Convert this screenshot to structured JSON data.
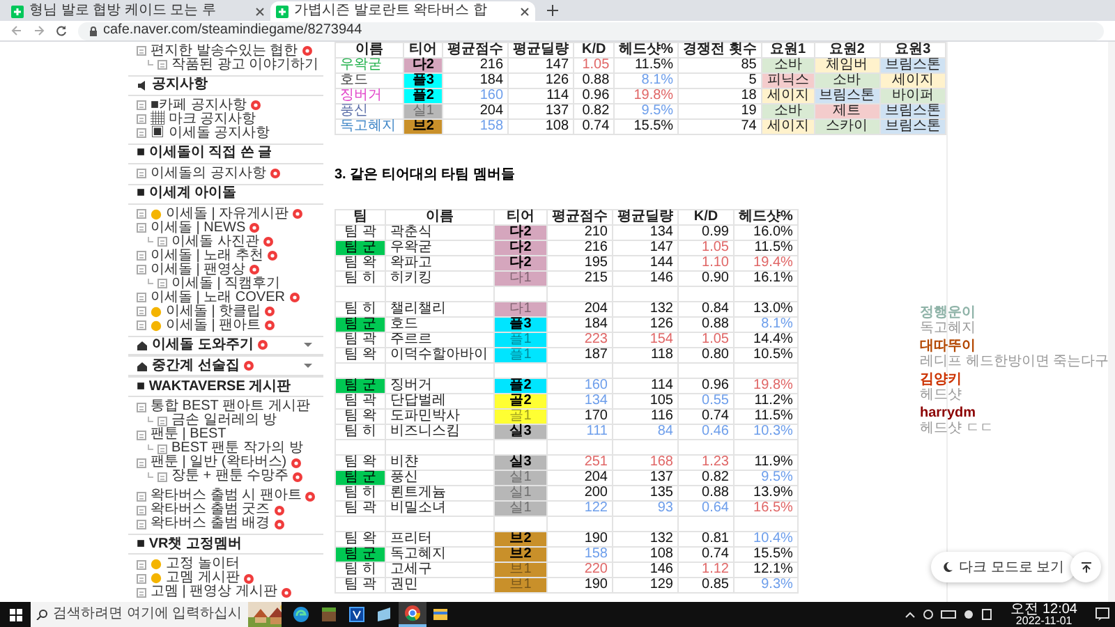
{
  "browser": {
    "tabs": [
      {
        "title": "형님 발로 협방 케이드 모는 루",
        "selected": false
      },
      {
        "title": "가볍시즌 발로란트 왁타버스 합",
        "selected": true
      }
    ],
    "url": "cafe.naver.com/steamindiegame/8273944"
  },
  "sidebar": [
    {
      "kind": "list",
      "items": [
        {
          "text": "편지한 발송수있는 협한",
          "new": true,
          "emoji": false,
          "children": [
            {
              "text": "작품된 광고 이야기하기",
              "new": false,
              "emoji": false
            }
          ]
        }
      ]
    },
    {
      "kind": "notice-section",
      "title": "공지사항",
      "new": false
    },
    {
      "kind": "list",
      "items": [
        {
          "text": "■카페 공지사항",
          "new": true,
          "emoji": false
        },
        {
          "text": "▦ 마크 공지사항",
          "new": false,
          "emoji": false
        },
        {
          "text": "▣ 이세돌 공지사항",
          "new": false,
          "emoji": false
        }
      ]
    },
    {
      "kind": "section",
      "title": "■ 이세돌이 직접 쓴 글",
      "new": false
    },
    {
      "kind": "list",
      "items": [
        {
          "text": "이세돌의 공지사항",
          "new": true,
          "emoji": false
        }
      ]
    },
    {
      "kind": "section",
      "title": "■ 이세계 아이돌",
      "new": false
    },
    {
      "kind": "list",
      "items": [
        {
          "text": "이세돌 | 자유게시판",
          "new": true,
          "emoji": true
        },
        {
          "text": "이세돌 | NEWS",
          "new": true,
          "emoji": false,
          "children": [
            {
              "text": "이세돌 사진관",
              "new": true,
              "emoji": false
            }
          ]
        },
        {
          "text": "이세돌 | 노래 추천",
          "new": true,
          "emoji": false
        },
        {
          "text": "이세돌 | 팬영상",
          "new": true,
          "emoji": false,
          "children": [
            {
              "text": "이세돌 | 직캠후기",
              "new": false,
              "emoji": false
            }
          ]
        },
        {
          "text": "이세돌 | 노래 COVER",
          "new": true,
          "emoji": false
        },
        {
          "text": "이세돌 | 핫클립",
          "new": true,
          "emoji": true
        },
        {
          "text": "이세돌 | 팬아트",
          "new": true,
          "emoji": true
        }
      ]
    },
    {
      "kind": "menu-section",
      "title": "이세돌 도와주기",
      "new": true,
      "expanded": false
    },
    {
      "kind": "menu-section",
      "title": "중간계 선술집",
      "new": true,
      "expanded": false
    },
    {
      "kind": "section",
      "title": "■ WAKTAVERSE 게시판",
      "new": false
    },
    {
      "kind": "list",
      "items": [
        {
          "text": "통합 BEST 팬아트 게시판",
          "new": false,
          "emoji": false,
          "children": [
            {
              "text": "금손 일러레의 방",
              "new": false,
              "emoji": false
            }
          ]
        },
        {
          "text": "팬툰 | BEST",
          "new": false,
          "emoji": false,
          "children": [
            {
              "text": "BEST 팬툰 작가의 방",
              "new": false,
              "emoji": false
            }
          ]
        },
        {
          "text": "팬툰 | 일반 (왁타버스)",
          "new": true,
          "emoji": false,
          "children": [
            {
              "text": "장툰 + 팬툰 수망주",
              "new": true,
              "emoji": false
            }
          ]
        }
      ]
    },
    {
      "kind": "list",
      "items": [
        {
          "text": "왁타버스 출범 시 팬아트",
          "new": true,
          "emoji": false
        },
        {
          "text": "왁타버스 출범 굿즈",
          "new": true,
          "emoji": false
        },
        {
          "text": "왁타버스 출범 배경",
          "new": true,
          "emoji": false
        }
      ]
    },
    {
      "kind": "section",
      "title": "■ VR챗 고정멤버",
      "new": false
    },
    {
      "kind": "list",
      "items": [
        {
          "text": "고정 놀이터",
          "new": false,
          "emoji": true
        },
        {
          "text": "고멤 게시판",
          "new": true,
          "emoji": true
        },
        {
          "text": "고멤 | 팬영상 게시판",
          "new": true,
          "emoji": false
        }
      ]
    }
  ],
  "summary_table": {
    "columns": [
      "이름",
      "티어",
      "평균점수",
      "평균딜량",
      "K/D",
      "헤드샷%",
      "경쟁전 횟수",
      "요원1",
      "요원2",
      "요원3"
    ],
    "rows": [
      [
        {
          "text": "우왁굳",
          "color": "#22b14c"
        },
        {
          "text": "다2",
          "color": "#d5a6bd",
          "faded": false
        },
        {
          "text": "216"
        },
        {
          "text": "147"
        },
        {
          "text": "1.05",
          "color": "#e06666"
        },
        {
          "text": "11.5%"
        },
        {
          "text": "85"
        },
        {
          "text": "소바",
          "color": "#d9ead3"
        },
        {
          "text": "체임버",
          "color": "#fff2cc"
        },
        {
          "text": "브림스톤",
          "color": "#cfe2f3"
        }
      ],
      [
        {
          "text": "호드",
          "color": "#434343"
        },
        {
          "text": "플3",
          "color": "#00ffff",
          "faded": false
        },
        {
          "text": "184"
        },
        {
          "text": "126"
        },
        {
          "text": "0.88"
        },
        {
          "text": "8.1%",
          "color": "#6d9eeb"
        },
        {
          "text": "5"
        },
        {
          "text": "피닉스",
          "color": "#f4cccc"
        },
        {
          "text": "소바",
          "color": "#d9ead3"
        },
        {
          "text": "세이지",
          "color": "#fff2cc"
        }
      ],
      [
        {
          "text": "징버거",
          "color": "#e040c8"
        },
        {
          "text": "플2",
          "color": "#00ffff",
          "faded": false
        },
        {
          "text": "160",
          "color": "#6d9eeb"
        },
        {
          "text": "114"
        },
        {
          "text": "0.96"
        },
        {
          "text": "19.8%",
          "color": "#e06666"
        },
        {
          "text": "18"
        },
        {
          "text": "세이지",
          "color": "#fff2cc"
        },
        {
          "text": "브림스톤",
          "color": "#cfe2f3"
        },
        {
          "text": "바이퍼",
          "color": "#d9ead3"
        }
      ],
      [
        {
          "text": "풍신",
          "color": "#5b6ea8"
        },
        {
          "text": "실1",
          "color": "#b7b7b7",
          "faded": true
        },
        {
          "text": "204"
        },
        {
          "text": "137"
        },
        {
          "text": "0.82"
        },
        {
          "text": "9.5%",
          "color": "#6d9eeb"
        },
        {
          "text": "19"
        },
        {
          "text": "소바",
          "color": "#d9ead3"
        },
        {
          "text": "제트",
          "color": "#f4cccc"
        },
        {
          "text": "브림스톤",
          "color": "#cfe2f3"
        }
      ],
      [
        {
          "text": "독고혜지",
          "color": "#3d85c6"
        },
        {
          "text": "브2",
          "color": "#c9902a",
          "faded": false
        },
        {
          "text": "158",
          "color": "#6d9eeb"
        },
        {
          "text": "108"
        },
        {
          "text": "0.74"
        },
        {
          "text": "15.5%"
        },
        {
          "text": "74"
        },
        {
          "text": "세이지",
          "color": "#fff2cc"
        },
        {
          "text": "스카이",
          "color": "#d9ead3"
        },
        {
          "text": "브림스톤",
          "color": "#cfe2f3"
        }
      ]
    ]
  },
  "section_heading": "3. 같은 티어대의 타팀 멤버들",
  "tier_table": {
    "columns": [
      "팀",
      "이름",
      "티어",
      "평균점수",
      "평균딜량",
      "K/D",
      "헤드샷%"
    ],
    "rows": [
      {
        "kind": "member",
        "cells": [
          {
            "text": "팀 곽",
            "highlighted": false
          },
          {
            "text": "곽춘식"
          },
          {
            "text": "다2",
            "color": "#d5a6bd",
            "faded": false
          },
          {
            "text": "210"
          },
          {
            "text": "134"
          },
          {
            "text": "0.99"
          },
          {
            "text": "16.0%"
          }
        ]
      },
      {
        "kind": "member",
        "cells": [
          {
            "text": "팀 군",
            "highlighted": true
          },
          {
            "text": "우왁굳"
          },
          {
            "text": "다2",
            "color": "#d5a6bd",
            "faded": false
          },
          {
            "text": "216"
          },
          {
            "text": "147"
          },
          {
            "text": "1.05",
            "color": "#e06666"
          },
          {
            "text": "11.5%"
          }
        ]
      },
      {
        "kind": "member",
        "cells": [
          {
            "text": "팀 왁",
            "highlighted": false
          },
          {
            "text": "왁파고"
          },
          {
            "text": "다2",
            "color": "#d5a6bd",
            "faded": false
          },
          {
            "text": "195"
          },
          {
            "text": "144"
          },
          {
            "text": "1.10",
            "color": "#e06666"
          },
          {
            "text": "19.4%",
            "color": "#e06666"
          }
        ]
      },
      {
        "kind": "member",
        "cells": [
          {
            "text": "팀 히",
            "highlighted": false
          },
          {
            "text": "히키킹"
          },
          {
            "text": "다1",
            "color": "#d5a6bd",
            "faded": true
          },
          {
            "text": "215"
          },
          {
            "text": "146"
          },
          {
            "text": "0.90"
          },
          {
            "text": "16.1%"
          }
        ]
      },
      {
        "kind": "spacer"
      },
      {
        "kind": "member",
        "cells": [
          {
            "text": "팀 히",
            "highlighted": false
          },
          {
            "text": "챌리챌리"
          },
          {
            "text": "다1",
            "color": "#d5a6bd",
            "faded": true
          },
          {
            "text": "204"
          },
          {
            "text": "132"
          },
          {
            "text": "0.84"
          },
          {
            "text": "13.0%"
          }
        ]
      },
      {
        "kind": "member",
        "cells": [
          {
            "text": "팀 군",
            "highlighted": true
          },
          {
            "text": "호드"
          },
          {
            "text": "플3",
            "color": "#00e5ff",
            "faded": false
          },
          {
            "text": "184"
          },
          {
            "text": "126"
          },
          {
            "text": "0.88"
          },
          {
            "text": "8.1%",
            "color": "#6d9eeb"
          }
        ]
      },
      {
        "kind": "member",
        "cells": [
          {
            "text": "팀 곽",
            "highlighted": false
          },
          {
            "text": "주르르"
          },
          {
            "text": "플1",
            "color": "#00e5ff",
            "faded": true
          },
          {
            "text": "223",
            "color": "#e06666"
          },
          {
            "text": "154",
            "color": "#e06666"
          },
          {
            "text": "1.05",
            "color": "#e06666"
          },
          {
            "text": "14.4%"
          }
        ]
      },
      {
        "kind": "member",
        "cells": [
          {
            "text": "팀 왁",
            "highlighted": false
          },
          {
            "text": "이덕수할아바이"
          },
          {
            "text": "플1",
            "color": "#00e5ff",
            "faded": true
          },
          {
            "text": "187"
          },
          {
            "text": "118"
          },
          {
            "text": "0.80"
          },
          {
            "text": "10.5%"
          }
        ]
      },
      {
        "kind": "spacer"
      },
      {
        "kind": "member",
        "cells": [
          {
            "text": "팀 군",
            "highlighted": true
          },
          {
            "text": "징버거"
          },
          {
            "text": "플2",
            "color": "#00e5ff",
            "faded": false
          },
          {
            "text": "160",
            "color": "#6d9eeb"
          },
          {
            "text": "114"
          },
          {
            "text": "0.96"
          },
          {
            "text": "19.8%",
            "color": "#e06666"
          }
        ]
      },
      {
        "kind": "member",
        "cells": [
          {
            "text": "팀 곽",
            "highlighted": false
          },
          {
            "text": "단답벌레"
          },
          {
            "text": "골2",
            "color": "#ffff33",
            "faded": false
          },
          {
            "text": "134",
            "color": "#6d9eeb"
          },
          {
            "text": "105"
          },
          {
            "text": "0.55",
            "color": "#6d9eeb"
          },
          {
            "text": "11.2%"
          }
        ]
      },
      {
        "kind": "member",
        "cells": [
          {
            "text": "팀 왁",
            "highlighted": false
          },
          {
            "text": "도파민박사"
          },
          {
            "text": "골1",
            "color": "#ffff33",
            "faded": true
          },
          {
            "text": "170"
          },
          {
            "text": "116"
          },
          {
            "text": "0.74"
          },
          {
            "text": "11.5%"
          }
        ]
      },
      {
        "kind": "member",
        "cells": [
          {
            "text": "팀 히",
            "highlighted": false
          },
          {
            "text": "비즈니스킴"
          },
          {
            "text": "실3",
            "color": "#b7b7b7",
            "faded": false
          },
          {
            "text": "111",
            "color": "#6d9eeb"
          },
          {
            "text": "84",
            "color": "#6d9eeb"
          },
          {
            "text": "0.46",
            "color": "#6d9eeb"
          },
          {
            "text": "10.3%",
            "color": "#6d9eeb"
          }
        ]
      },
      {
        "kind": "spacer"
      },
      {
        "kind": "member",
        "cells": [
          {
            "text": "팀 왁",
            "highlighted": false
          },
          {
            "text": "비챤"
          },
          {
            "text": "실3",
            "color": "#b7b7b7",
            "faded": false
          },
          {
            "text": "251",
            "color": "#e06666"
          },
          {
            "text": "168",
            "color": "#e06666"
          },
          {
            "text": "1.23",
            "color": "#e06666"
          },
          {
            "text": "11.9%"
          }
        ]
      },
      {
        "kind": "member",
        "cells": [
          {
            "text": "팀 군",
            "highlighted": true
          },
          {
            "text": "풍신"
          },
          {
            "text": "실1",
            "color": "#b7b7b7",
            "faded": true
          },
          {
            "text": "204"
          },
          {
            "text": "137"
          },
          {
            "text": "0.82"
          },
          {
            "text": "9.5%",
            "color": "#6d9eeb"
          }
        ]
      },
      {
        "kind": "member",
        "cells": [
          {
            "text": "팀 히",
            "highlighted": false
          },
          {
            "text": "뢴트게늄"
          },
          {
            "text": "실1",
            "color": "#b7b7b7",
            "faded": true
          },
          {
            "text": "200"
          },
          {
            "text": "135"
          },
          {
            "text": "0.88"
          },
          {
            "text": "13.9%"
          }
        ]
      },
      {
        "kind": "member",
        "cells": [
          {
            "text": "팀 곽",
            "highlighted": false
          },
          {
            "text": "비밀소녀"
          },
          {
            "text": "실1",
            "color": "#b7b7b7",
            "faded": true
          },
          {
            "text": "122",
            "color": "#6d9eeb"
          },
          {
            "text": "93",
            "color": "#6d9eeb"
          },
          {
            "text": "0.64",
            "color": "#6d9eeb"
          },
          {
            "text": "16.5%",
            "color": "#e06666"
          }
        ]
      },
      {
        "kind": "spacer"
      },
      {
        "kind": "member",
        "cells": [
          {
            "text": "팀 왁",
            "highlighted": false
          },
          {
            "text": "프리터"
          },
          {
            "text": "브2",
            "color": "#c9902a",
            "faded": false
          },
          {
            "text": "190"
          },
          {
            "text": "132"
          },
          {
            "text": "0.81"
          },
          {
            "text": "10.4%",
            "color": "#6d9eeb"
          }
        ]
      },
      {
        "kind": "member",
        "cells": [
          {
            "text": "팀 군",
            "highlighted": true
          },
          {
            "text": "독고혜지"
          },
          {
            "text": "브2",
            "color": "#c9902a",
            "faded": false
          },
          {
            "text": "158",
            "color": "#6d9eeb"
          },
          {
            "text": "108"
          },
          {
            "text": "0.74"
          },
          {
            "text": "15.5%"
          }
        ]
      },
      {
        "kind": "member",
        "cells": [
          {
            "text": "팀 히",
            "highlighted": false
          },
          {
            "text": "고세구"
          },
          {
            "text": "브1",
            "color": "#c9902a",
            "faded": true
          },
          {
            "text": "220",
            "color": "#e06666"
          },
          {
            "text": "146"
          },
          {
            "text": "1.12",
            "color": "#e06666"
          },
          {
            "text": "12.1%"
          }
        ]
      },
      {
        "kind": "member",
        "cells": [
          {
            "text": "팀 곽",
            "highlighted": false
          },
          {
            "text": "권민"
          },
          {
            "text": "브1",
            "color": "#c9902a",
            "faded": true
          },
          {
            "text": "190"
          },
          {
            "text": "129"
          },
          {
            "text": "0.85"
          },
          {
            "text": "9.3%",
            "color": "#6d9eeb"
          }
        ]
      }
    ]
  },
  "chat": [
    {
      "user": "정행운이",
      "color": "#8fb3a8",
      "message": "독고혜지"
    },
    {
      "user": "대따뚜이",
      "color": "#b34700",
      "message": "레디프 헤드한방이면 죽는다구"
    },
    {
      "user": "김양키",
      "color": "#cc3300",
      "message": "헤드샷"
    },
    {
      "user": "harrydm",
      "color": "#8b0000",
      "message": "헤드샷 ㄷㄷ"
    }
  ],
  "dark_mode_button": "다크 모드로 보기",
  "taskbar": {
    "search_placeholder": "검색하려면 여기에 입력하십시",
    "apps": [
      {
        "kind": "edge",
        "selected": false
      },
      {
        "kind": "blocks",
        "selected": false
      },
      {
        "kind": "editor",
        "selected": false
      },
      {
        "kind": "window",
        "selected": false
      },
      {
        "kind": "chrome",
        "selected": true
      },
      {
        "kind": "folder",
        "selected": false
      }
    ],
    "time": "오전 12:04",
    "date": "2022-11-01"
  }
}
